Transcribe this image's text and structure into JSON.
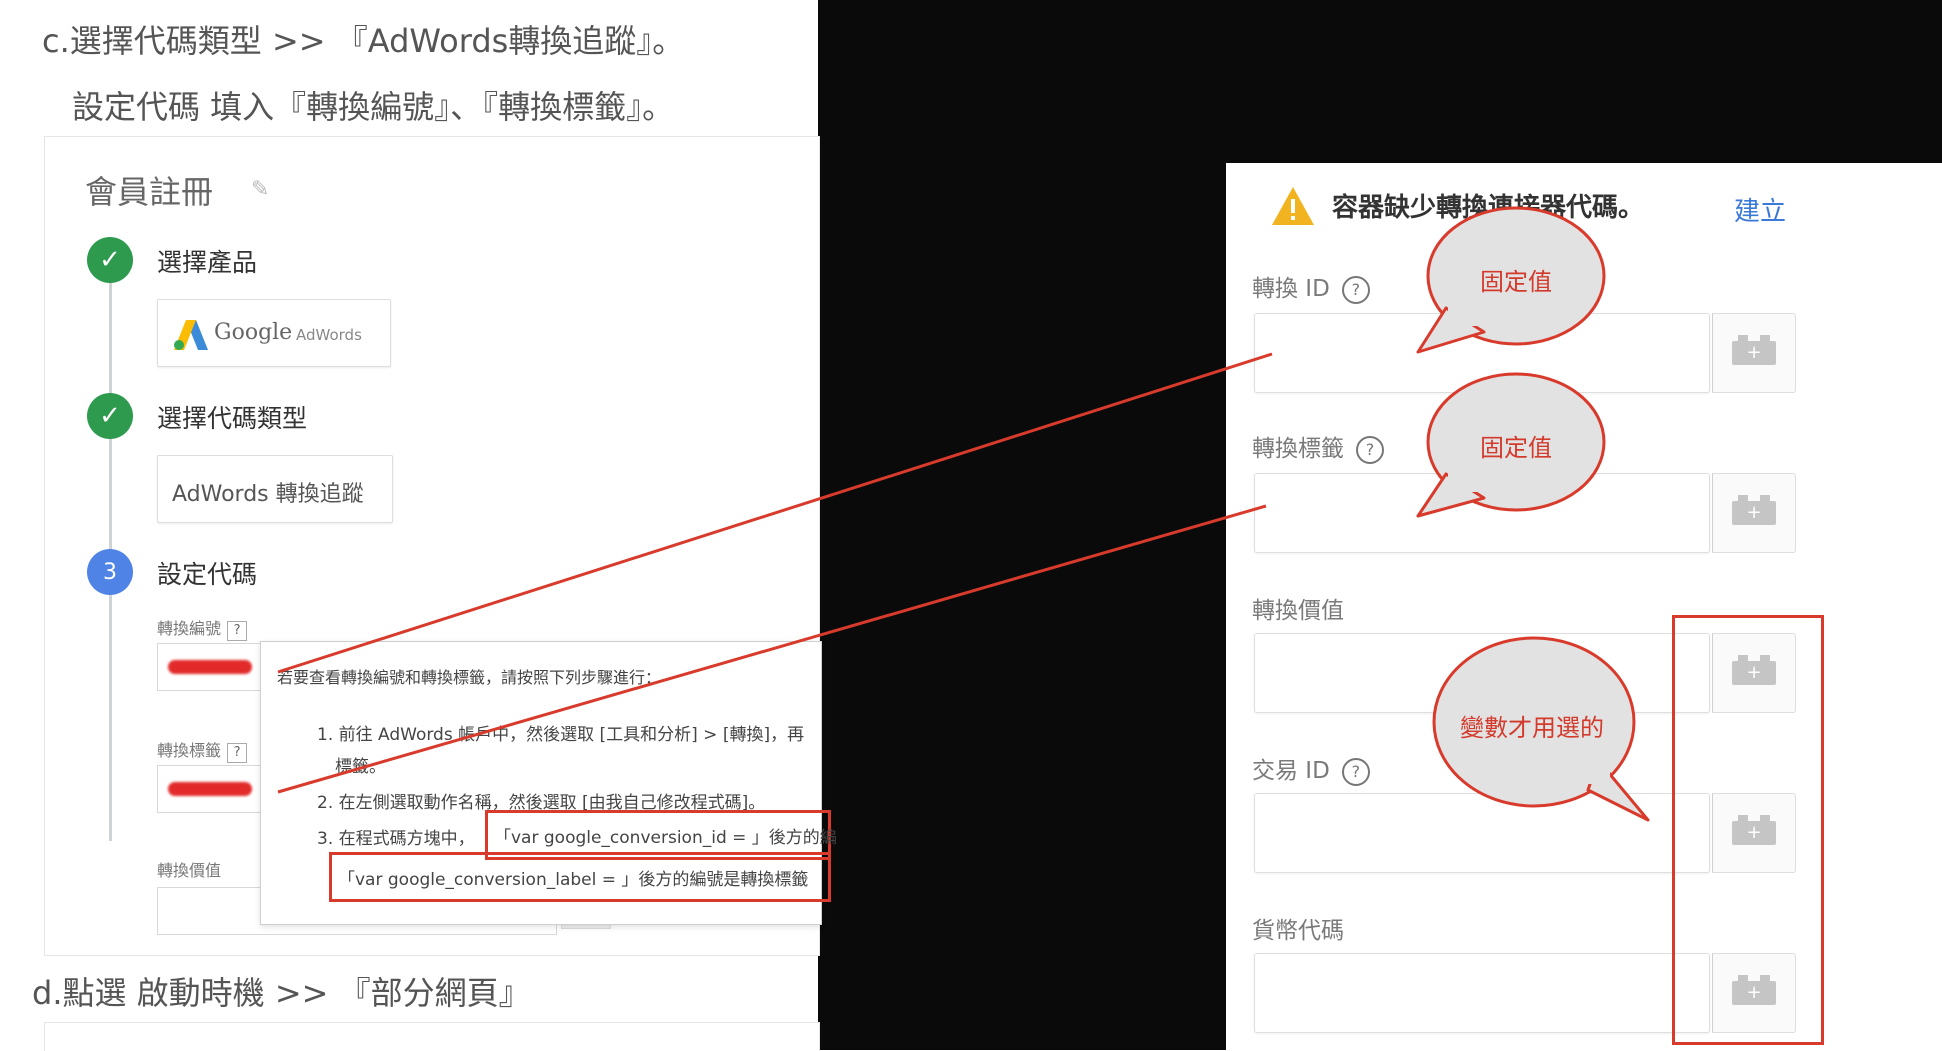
{
  "left": {
    "heading_c": "c.選擇代碼類型 >> 『AdWords轉換追蹤』。",
    "heading_c2": "設定代碼 填入『轉換編號』、『轉換標籤』。",
    "heading_d": "d.點選 啟動時機 >> 『部分網頁』",
    "card_title": "會員註冊",
    "steps": [
      {
        "label": "選擇產品"
      },
      {
        "label": "選擇代碼類型"
      },
      {
        "label": "設定代碼",
        "number": "3"
      }
    ],
    "product_logo_text": "Google",
    "product_logo_sub": "AdWords",
    "tag_type_chip": "AdWords 轉換追蹤",
    "fields": {
      "conversion_id": "轉換編號",
      "conversion_label": "轉換標籤",
      "conversion_value": "轉換價值",
      "help_mark": "?"
    },
    "help_popup": {
      "intro": "若要查看轉換編號和轉換標籤，請按照下列步驟進行：",
      "line1": "1. 前往 AdWords 帳戶中，然後選取 [工具和分析] > [轉換]，再",
      "line1b": "標籤。",
      "line2": "2. 在左側選取動作名稱，然後選取 [由我自己修改程式碼]。",
      "line3": "3. 在程式碼方塊中，",
      "line3_code": "「var google_conversion_id = 」後方的編",
      "line4_code": "「var google_conversion_label = 」後方的編號是轉換標籤"
    }
  },
  "right": {
    "warning": "容器缺少轉換連接器代碼。",
    "create_link": "建立",
    "fields": [
      {
        "label": "轉換 ID",
        "help": "?"
      },
      {
        "label": "轉換標籤",
        "help": "?"
      },
      {
        "label": "轉換價值"
      },
      {
        "label": "交易 ID",
        "help": "?"
      },
      {
        "label": "貨幣代碼"
      }
    ],
    "bubble_fixed_1": "固定值",
    "bubble_fixed_2": "固定值",
    "bubble_variable": "變數才用選的",
    "var_button_glyph": "+"
  },
  "colors": {
    "annotation_red": "#d83a2b",
    "bubble_fill": "#e2e2e2",
    "check_green": "#2e9a4e",
    "step_blue": "#4f84e6",
    "link_blue": "#3b79d8",
    "warning_yellow": "#f2b321"
  }
}
